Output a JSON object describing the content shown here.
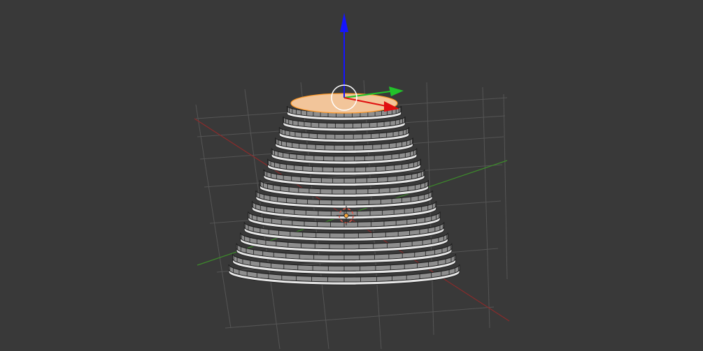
{
  "viewport": {
    "background": "#393939",
    "grid_color": "#555555",
    "x_axis_color": "#8a2b2b",
    "y_axis_color": "#3d8a2b"
  },
  "mesh": {
    "type": "stepped-cone",
    "side_color": "#8e8e8e",
    "step_color": "#e8e8e8",
    "edge_color": "#1e1e1e",
    "selected_face_color": "#f2c59a",
    "selected_face_edge_color": "#ff9a2a"
  },
  "gizmo": {
    "z_axis_color": "#1414ff",
    "y_axis_color": "#22c22a",
    "x_axis_color": "#e01010",
    "rotate_circle_color": "#ffffff"
  },
  "origin": {
    "cursor_color": "#e25a4a",
    "dot_color": "#f3a33a"
  }
}
